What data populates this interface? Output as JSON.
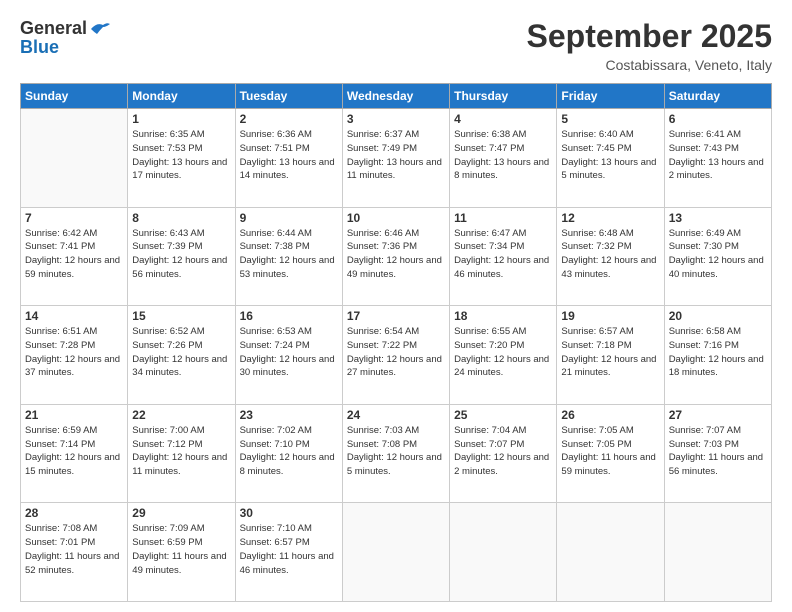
{
  "logo": {
    "general": "General",
    "blue": "Blue"
  },
  "header": {
    "month": "September 2025",
    "location": "Costabissara, Veneto, Italy"
  },
  "weekdays": [
    "Sunday",
    "Monday",
    "Tuesday",
    "Wednesday",
    "Thursday",
    "Friday",
    "Saturday"
  ],
  "weeks": [
    [
      {
        "day": "",
        "sunrise": "",
        "sunset": "",
        "daylight": ""
      },
      {
        "day": "1",
        "sunrise": "Sunrise: 6:35 AM",
        "sunset": "Sunset: 7:53 PM",
        "daylight": "Daylight: 13 hours and 17 minutes."
      },
      {
        "day": "2",
        "sunrise": "Sunrise: 6:36 AM",
        "sunset": "Sunset: 7:51 PM",
        "daylight": "Daylight: 13 hours and 14 minutes."
      },
      {
        "day": "3",
        "sunrise": "Sunrise: 6:37 AM",
        "sunset": "Sunset: 7:49 PM",
        "daylight": "Daylight: 13 hours and 11 minutes."
      },
      {
        "day": "4",
        "sunrise": "Sunrise: 6:38 AM",
        "sunset": "Sunset: 7:47 PM",
        "daylight": "Daylight: 13 hours and 8 minutes."
      },
      {
        "day": "5",
        "sunrise": "Sunrise: 6:40 AM",
        "sunset": "Sunset: 7:45 PM",
        "daylight": "Daylight: 13 hours and 5 minutes."
      },
      {
        "day": "6",
        "sunrise": "Sunrise: 6:41 AM",
        "sunset": "Sunset: 7:43 PM",
        "daylight": "Daylight: 13 hours and 2 minutes."
      }
    ],
    [
      {
        "day": "7",
        "sunrise": "Sunrise: 6:42 AM",
        "sunset": "Sunset: 7:41 PM",
        "daylight": "Daylight: 12 hours and 59 minutes."
      },
      {
        "day": "8",
        "sunrise": "Sunrise: 6:43 AM",
        "sunset": "Sunset: 7:39 PM",
        "daylight": "Daylight: 12 hours and 56 minutes."
      },
      {
        "day": "9",
        "sunrise": "Sunrise: 6:44 AM",
        "sunset": "Sunset: 7:38 PM",
        "daylight": "Daylight: 12 hours and 53 minutes."
      },
      {
        "day": "10",
        "sunrise": "Sunrise: 6:46 AM",
        "sunset": "Sunset: 7:36 PM",
        "daylight": "Daylight: 12 hours and 49 minutes."
      },
      {
        "day": "11",
        "sunrise": "Sunrise: 6:47 AM",
        "sunset": "Sunset: 7:34 PM",
        "daylight": "Daylight: 12 hours and 46 minutes."
      },
      {
        "day": "12",
        "sunrise": "Sunrise: 6:48 AM",
        "sunset": "Sunset: 7:32 PM",
        "daylight": "Daylight: 12 hours and 43 minutes."
      },
      {
        "day": "13",
        "sunrise": "Sunrise: 6:49 AM",
        "sunset": "Sunset: 7:30 PM",
        "daylight": "Daylight: 12 hours and 40 minutes."
      }
    ],
    [
      {
        "day": "14",
        "sunrise": "Sunrise: 6:51 AM",
        "sunset": "Sunset: 7:28 PM",
        "daylight": "Daylight: 12 hours and 37 minutes."
      },
      {
        "day": "15",
        "sunrise": "Sunrise: 6:52 AM",
        "sunset": "Sunset: 7:26 PM",
        "daylight": "Daylight: 12 hours and 34 minutes."
      },
      {
        "day": "16",
        "sunrise": "Sunrise: 6:53 AM",
        "sunset": "Sunset: 7:24 PM",
        "daylight": "Daylight: 12 hours and 30 minutes."
      },
      {
        "day": "17",
        "sunrise": "Sunrise: 6:54 AM",
        "sunset": "Sunset: 7:22 PM",
        "daylight": "Daylight: 12 hours and 27 minutes."
      },
      {
        "day": "18",
        "sunrise": "Sunrise: 6:55 AM",
        "sunset": "Sunset: 7:20 PM",
        "daylight": "Daylight: 12 hours and 24 minutes."
      },
      {
        "day": "19",
        "sunrise": "Sunrise: 6:57 AM",
        "sunset": "Sunset: 7:18 PM",
        "daylight": "Daylight: 12 hours and 21 minutes."
      },
      {
        "day": "20",
        "sunrise": "Sunrise: 6:58 AM",
        "sunset": "Sunset: 7:16 PM",
        "daylight": "Daylight: 12 hours and 18 minutes."
      }
    ],
    [
      {
        "day": "21",
        "sunrise": "Sunrise: 6:59 AM",
        "sunset": "Sunset: 7:14 PM",
        "daylight": "Daylight: 12 hours and 15 minutes."
      },
      {
        "day": "22",
        "sunrise": "Sunrise: 7:00 AM",
        "sunset": "Sunset: 7:12 PM",
        "daylight": "Daylight: 12 hours and 11 minutes."
      },
      {
        "day": "23",
        "sunrise": "Sunrise: 7:02 AM",
        "sunset": "Sunset: 7:10 PM",
        "daylight": "Daylight: 12 hours and 8 minutes."
      },
      {
        "day": "24",
        "sunrise": "Sunrise: 7:03 AM",
        "sunset": "Sunset: 7:08 PM",
        "daylight": "Daylight: 12 hours and 5 minutes."
      },
      {
        "day": "25",
        "sunrise": "Sunrise: 7:04 AM",
        "sunset": "Sunset: 7:07 PM",
        "daylight": "Daylight: 12 hours and 2 minutes."
      },
      {
        "day": "26",
        "sunrise": "Sunrise: 7:05 AM",
        "sunset": "Sunset: 7:05 PM",
        "daylight": "Daylight: 11 hours and 59 minutes."
      },
      {
        "day": "27",
        "sunrise": "Sunrise: 7:07 AM",
        "sunset": "Sunset: 7:03 PM",
        "daylight": "Daylight: 11 hours and 56 minutes."
      }
    ],
    [
      {
        "day": "28",
        "sunrise": "Sunrise: 7:08 AM",
        "sunset": "Sunset: 7:01 PM",
        "daylight": "Daylight: 11 hours and 52 minutes."
      },
      {
        "day": "29",
        "sunrise": "Sunrise: 7:09 AM",
        "sunset": "Sunset: 6:59 PM",
        "daylight": "Daylight: 11 hours and 49 minutes."
      },
      {
        "day": "30",
        "sunrise": "Sunrise: 7:10 AM",
        "sunset": "Sunset: 6:57 PM",
        "daylight": "Daylight: 11 hours and 46 minutes."
      },
      {
        "day": "",
        "sunrise": "",
        "sunset": "",
        "daylight": ""
      },
      {
        "day": "",
        "sunrise": "",
        "sunset": "",
        "daylight": ""
      },
      {
        "day": "",
        "sunrise": "",
        "sunset": "",
        "daylight": ""
      },
      {
        "day": "",
        "sunrise": "",
        "sunset": "",
        "daylight": ""
      }
    ]
  ]
}
